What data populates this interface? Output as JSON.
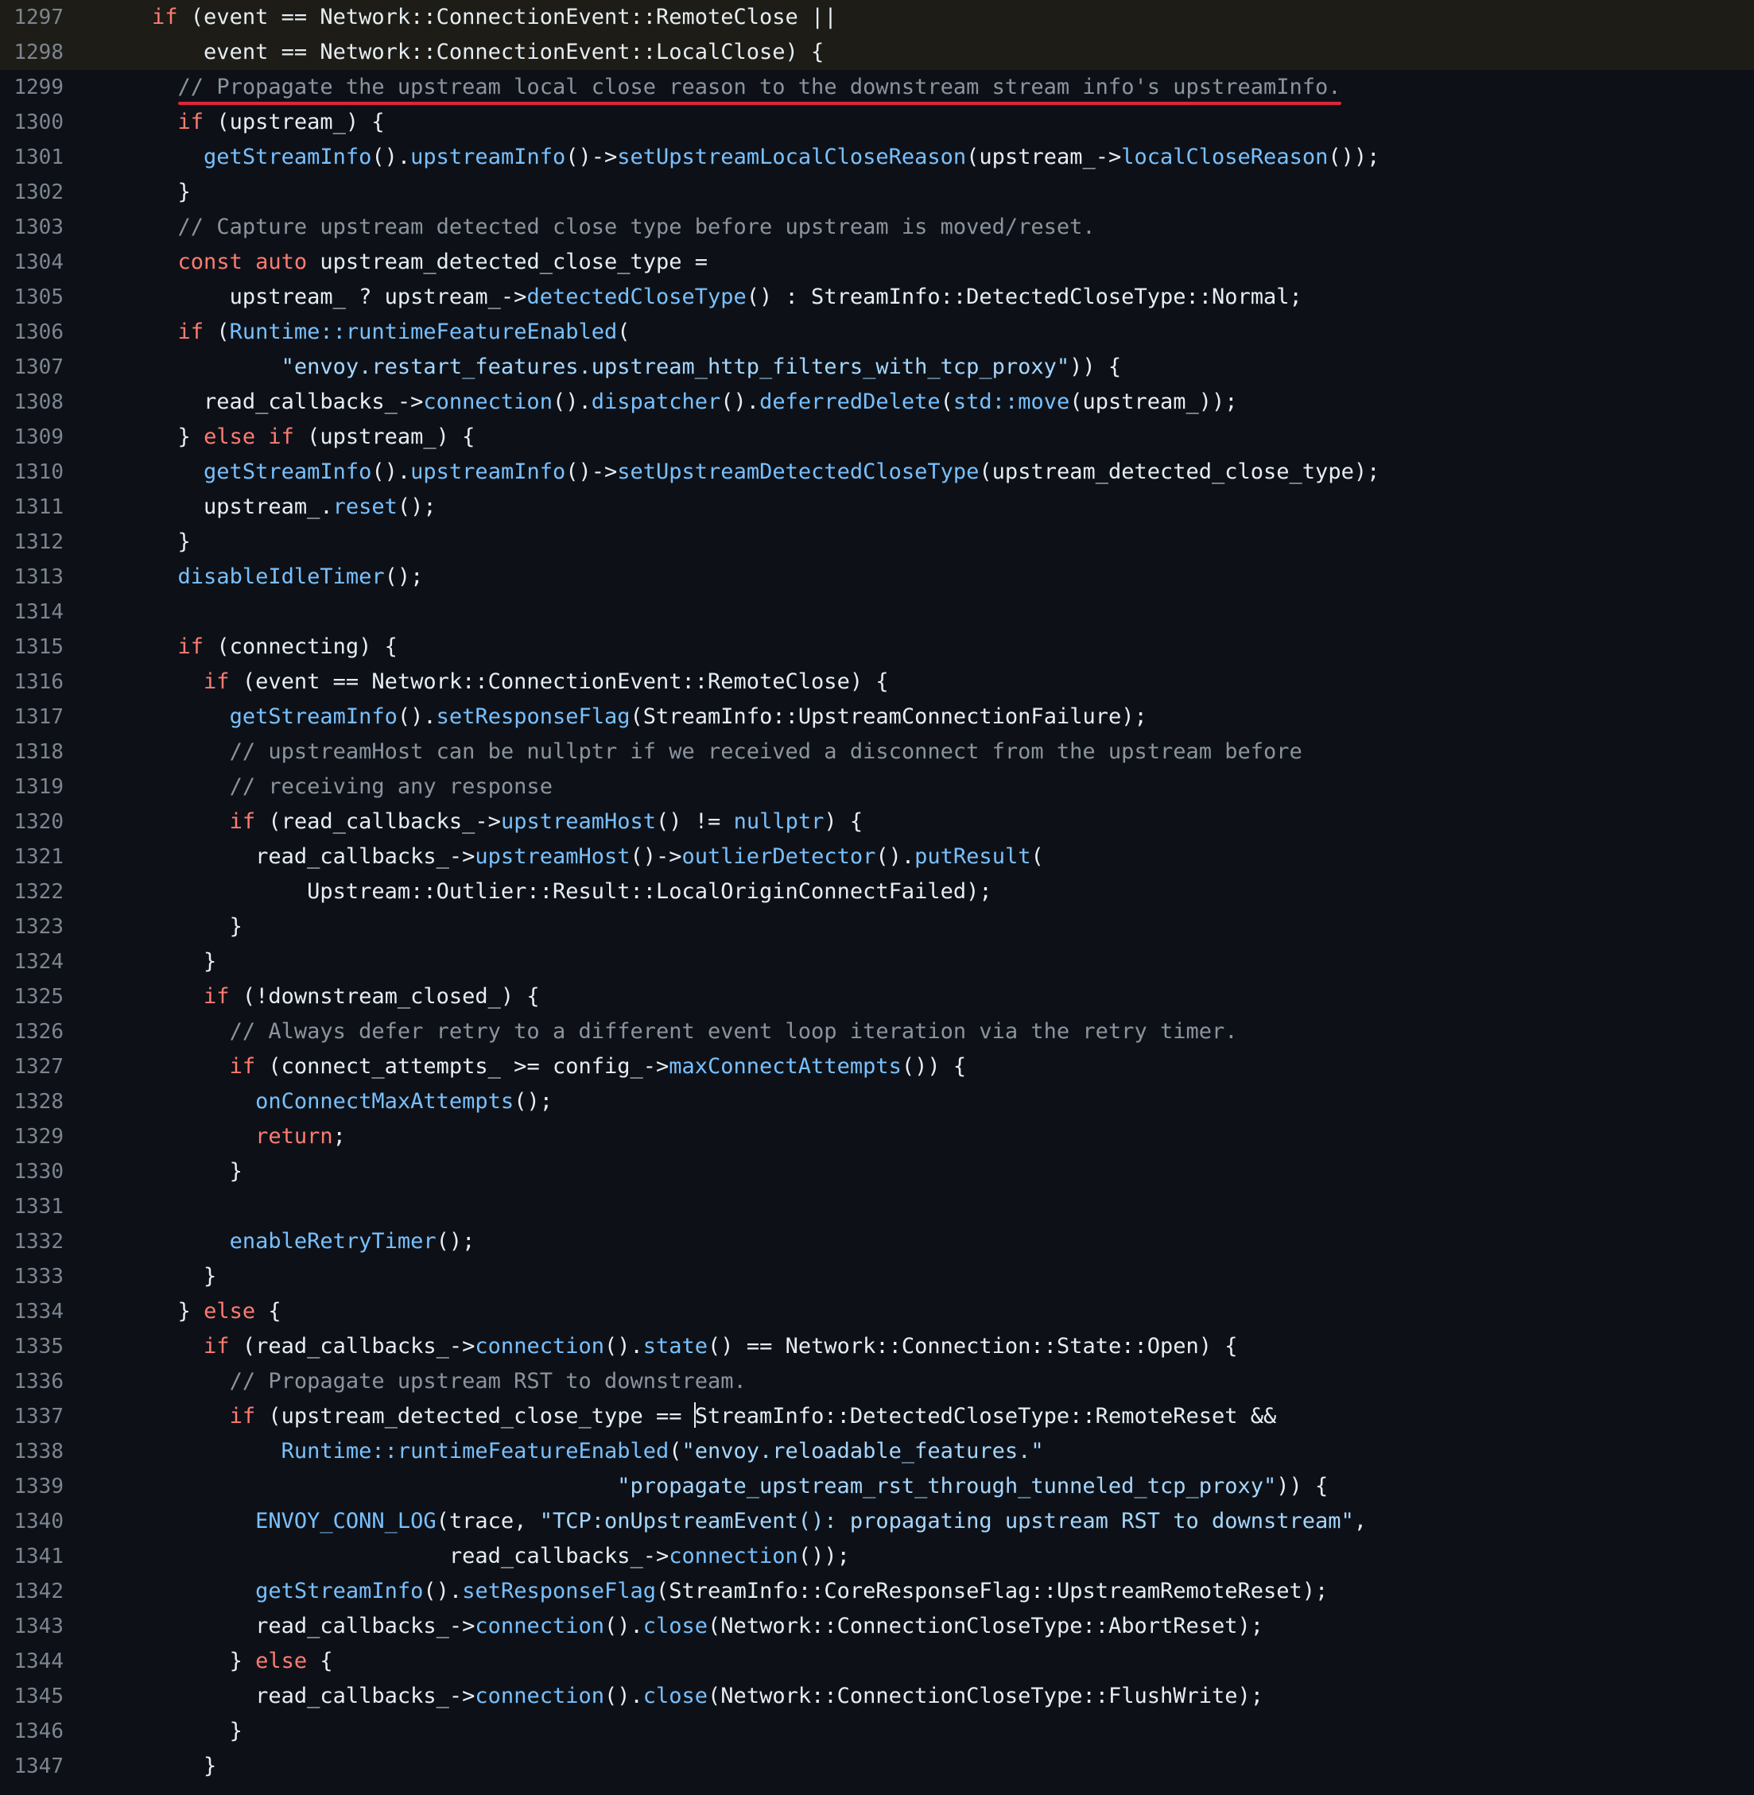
{
  "colors": {
    "background": "#0d1117",
    "highlight": "#1d1c16",
    "keyword": "#ff7b72",
    "function": "#79c0ff",
    "comment": "#8b949e",
    "string": "#a5d6ff",
    "text": "#e6edf3",
    "line_number": "#7d8590",
    "annotation": "#e0243c"
  },
  "code": {
    "highlighted_lines": [
      1297,
      1298
    ],
    "annotated_line": 1299,
    "caret_line": 1337,
    "lines": [
      {
        "n": "1297",
        "indent": 2,
        "tokens": [
          [
            "k",
            "if"
          ],
          [
            "t",
            " (event == Network::ConnectionEvent::RemoteClose ||"
          ]
        ]
      },
      {
        "n": "1298",
        "indent": 4,
        "tokens": [
          [
            "t",
            "event == Network::ConnectionEvent::LocalClose) {"
          ]
        ]
      },
      {
        "n": "1299",
        "indent": 3,
        "tokens": [
          [
            "c",
            "// Propagate the upstream local close reason to the downstream stream info's upstreamInfo."
          ]
        ]
      },
      {
        "n": "1300",
        "indent": 3,
        "tokens": [
          [
            "k",
            "if"
          ],
          [
            "t",
            " (upstream_) {"
          ]
        ]
      },
      {
        "n": "1301",
        "indent": 4,
        "tokens": [
          [
            "f",
            "getStreamInfo"
          ],
          [
            "t",
            "()."
          ],
          [
            "f",
            "upstreamInfo"
          ],
          [
            "t",
            "()->"
          ],
          [
            "f",
            "setUpstreamLocalCloseReason"
          ],
          [
            "t",
            "(upstream_->"
          ],
          [
            "f",
            "localCloseReason"
          ],
          [
            "t",
            "());"
          ]
        ]
      },
      {
        "n": "1302",
        "indent": 3,
        "tokens": [
          [
            "t",
            "}"
          ]
        ]
      },
      {
        "n": "1303",
        "indent": 3,
        "tokens": [
          [
            "c",
            "// Capture upstream detected close type before upstream is moved/reset."
          ]
        ]
      },
      {
        "n": "1304",
        "indent": 3,
        "tokens": [
          [
            "k",
            "const auto"
          ],
          [
            "t",
            " upstream_detected_close_type ="
          ]
        ]
      },
      {
        "n": "1305",
        "indent": 5,
        "tokens": [
          [
            "t",
            "upstream_ ? upstream_->"
          ],
          [
            "f",
            "detectedCloseType"
          ],
          [
            "t",
            "() : StreamInfo::DetectedCloseType::Normal;"
          ]
        ]
      },
      {
        "n": "1306",
        "indent": 3,
        "tokens": [
          [
            "k",
            "if"
          ],
          [
            "t",
            " ("
          ],
          [
            "f",
            "Runtime::runtimeFeatureEnabled"
          ],
          [
            "t",
            "("
          ]
        ]
      },
      {
        "n": "1307",
        "indent": 7,
        "tokens": [
          [
            "s",
            "\"envoy.restart_features.upstream_http_filters_with_tcp_proxy\""
          ],
          [
            "t",
            ")) {"
          ]
        ]
      },
      {
        "n": "1308",
        "indent": 4,
        "tokens": [
          [
            "t",
            "read_callbacks_->"
          ],
          [
            "f",
            "connection"
          ],
          [
            "t",
            "()."
          ],
          [
            "f",
            "dispatcher"
          ],
          [
            "t",
            "()."
          ],
          [
            "f",
            "deferredDelete"
          ],
          [
            "t",
            "("
          ],
          [
            "f",
            "std::move"
          ],
          [
            "t",
            "(upstream_));"
          ]
        ]
      },
      {
        "n": "1309",
        "indent": 3,
        "tokens": [
          [
            "t",
            "} "
          ],
          [
            "k",
            "else if"
          ],
          [
            "t",
            " (upstream_) {"
          ]
        ]
      },
      {
        "n": "1310",
        "indent": 4,
        "tokens": [
          [
            "f",
            "getStreamInfo"
          ],
          [
            "t",
            "()."
          ],
          [
            "f",
            "upstreamInfo"
          ],
          [
            "t",
            "()->"
          ],
          [
            "f",
            "setUpstreamDetectedCloseType"
          ],
          [
            "t",
            "(upstream_detected_close_type);"
          ]
        ]
      },
      {
        "n": "1311",
        "indent": 4,
        "tokens": [
          [
            "t",
            "upstream_."
          ],
          [
            "f",
            "reset"
          ],
          [
            "t",
            "();"
          ]
        ]
      },
      {
        "n": "1312",
        "indent": 3,
        "tokens": [
          [
            "t",
            "}"
          ]
        ]
      },
      {
        "n": "1313",
        "indent": 3,
        "tokens": [
          [
            "f",
            "disableIdleTimer"
          ],
          [
            "t",
            "();"
          ]
        ]
      },
      {
        "n": "1314",
        "indent": 0,
        "tokens": []
      },
      {
        "n": "1315",
        "indent": 3,
        "tokens": [
          [
            "k",
            "if"
          ],
          [
            "t",
            " (connecting) {"
          ]
        ]
      },
      {
        "n": "1316",
        "indent": 4,
        "tokens": [
          [
            "k",
            "if"
          ],
          [
            "t",
            " (event == Network::ConnectionEvent::RemoteClose) {"
          ]
        ]
      },
      {
        "n": "1317",
        "indent": 5,
        "tokens": [
          [
            "f",
            "getStreamInfo"
          ],
          [
            "t",
            "()."
          ],
          [
            "f",
            "setResponseFlag"
          ],
          [
            "t",
            "(StreamInfo::UpstreamConnectionFailure);"
          ]
        ]
      },
      {
        "n": "1318",
        "indent": 5,
        "tokens": [
          [
            "c",
            "// upstreamHost can be nullptr if we received a disconnect from the upstream before"
          ]
        ]
      },
      {
        "n": "1319",
        "indent": 5,
        "tokens": [
          [
            "c",
            "// receiving any response"
          ]
        ]
      },
      {
        "n": "1320",
        "indent": 5,
        "tokens": [
          [
            "k",
            "if"
          ],
          [
            "t",
            " (read_callbacks_->"
          ],
          [
            "f",
            "upstreamHost"
          ],
          [
            "t",
            "() != "
          ],
          [
            "f",
            "nullptr"
          ],
          [
            "t",
            ") {"
          ]
        ]
      },
      {
        "n": "1321",
        "indent": 6,
        "tokens": [
          [
            "t",
            "read_callbacks_->"
          ],
          [
            "f",
            "upstreamHost"
          ],
          [
            "t",
            "()->"
          ],
          [
            "f",
            "outlierDetector"
          ],
          [
            "t",
            "()."
          ],
          [
            "f",
            "putResult"
          ],
          [
            "t",
            "("
          ]
        ]
      },
      {
        "n": "1322",
        "indent": 8,
        "tokens": [
          [
            "t",
            "Upstream::Outlier::Result::LocalOriginConnectFailed);"
          ]
        ]
      },
      {
        "n": "1323",
        "indent": 5,
        "tokens": [
          [
            "t",
            "}"
          ]
        ]
      },
      {
        "n": "1324",
        "indent": 4,
        "tokens": [
          [
            "t",
            "}"
          ]
        ]
      },
      {
        "n": "1325",
        "indent": 4,
        "tokens": [
          [
            "k",
            "if"
          ],
          [
            "t",
            " (!downstream_closed_) {"
          ]
        ]
      },
      {
        "n": "1326",
        "indent": 5,
        "tokens": [
          [
            "c",
            "// Always defer retry to a different event loop iteration via the retry timer."
          ]
        ]
      },
      {
        "n": "1327",
        "indent": 5,
        "tokens": [
          [
            "k",
            "if"
          ],
          [
            "t",
            " (connect_attempts_ >= config_->"
          ],
          [
            "f",
            "maxConnectAttempts"
          ],
          [
            "t",
            "()) {"
          ]
        ]
      },
      {
        "n": "1328",
        "indent": 6,
        "tokens": [
          [
            "f",
            "onConnectMaxAttempts"
          ],
          [
            "t",
            "();"
          ]
        ]
      },
      {
        "n": "1329",
        "indent": 6,
        "tokens": [
          [
            "k",
            "return"
          ],
          [
            "t",
            ";"
          ]
        ]
      },
      {
        "n": "1330",
        "indent": 5,
        "tokens": [
          [
            "t",
            "}"
          ]
        ]
      },
      {
        "n": "1331",
        "indent": 0,
        "tokens": []
      },
      {
        "n": "1332",
        "indent": 5,
        "tokens": [
          [
            "f",
            "enableRetryTimer"
          ],
          [
            "t",
            "();"
          ]
        ]
      },
      {
        "n": "1333",
        "indent": 4,
        "tokens": [
          [
            "t",
            "}"
          ]
        ]
      },
      {
        "n": "1334",
        "indent": 3,
        "tokens": [
          [
            "t",
            "} "
          ],
          [
            "k",
            "else"
          ],
          [
            "t",
            " {"
          ]
        ]
      },
      {
        "n": "1335",
        "indent": 4,
        "tokens": [
          [
            "k",
            "if"
          ],
          [
            "t",
            " (read_callbacks_->"
          ],
          [
            "f",
            "connection"
          ],
          [
            "t",
            "()."
          ],
          [
            "f",
            "state"
          ],
          [
            "t",
            "() == Network::Connection::State::Open) {"
          ]
        ]
      },
      {
        "n": "1336",
        "indent": 5,
        "tokens": [
          [
            "c",
            "// Propagate upstream RST to downstream."
          ]
        ]
      },
      {
        "n": "1337",
        "indent": 5,
        "tokens": [
          [
            "k",
            "if"
          ],
          [
            "t",
            " (upstream_detected_close_type == StreamInfo::DetectedCloseType::RemoteReset &&"
          ]
        ]
      },
      {
        "n": "1338",
        "indent": 7,
        "tokens": [
          [
            "f",
            "Runtime::runtimeFeatureEnabled"
          ],
          [
            "t",
            "("
          ],
          [
            "s",
            "\"envoy.reloadable_features.\""
          ]
        ]
      },
      {
        "n": "1339",
        "indent": 0,
        "pad": "                                        ",
        "tokens": [
          [
            "s",
            "\"propagate_upstream_rst_through_tunneled_tcp_proxy\""
          ],
          [
            "t",
            ")) {"
          ]
        ]
      },
      {
        "n": "1340",
        "indent": 6,
        "tokens": [
          [
            "f",
            "ENVOY_CONN_LOG"
          ],
          [
            "t",
            "(trace, "
          ],
          [
            "s",
            "\"TCP:onUpstreamEvent(): propagating upstream RST to downstream\""
          ],
          [
            "t",
            ","
          ]
        ]
      },
      {
        "n": "1341",
        "indent": 0,
        "pad": "                           ",
        "tokens": [
          [
            "t",
            "read_callbacks_->"
          ],
          [
            "f",
            "connection"
          ],
          [
            "t",
            "());"
          ]
        ]
      },
      {
        "n": "1342",
        "indent": 6,
        "tokens": [
          [
            "f",
            "getStreamInfo"
          ],
          [
            "t",
            "()."
          ],
          [
            "f",
            "setResponseFlag"
          ],
          [
            "t",
            "(StreamInfo::CoreResponseFlag::UpstreamRemoteReset);"
          ]
        ]
      },
      {
        "n": "1343",
        "indent": 6,
        "tokens": [
          [
            "t",
            "read_callbacks_->"
          ],
          [
            "f",
            "connection"
          ],
          [
            "t",
            "()."
          ],
          [
            "f",
            "close"
          ],
          [
            "t",
            "(Network::ConnectionCloseType::AbortReset);"
          ]
        ]
      },
      {
        "n": "1344",
        "indent": 5,
        "tokens": [
          [
            "t",
            "} "
          ],
          [
            "k",
            "else"
          ],
          [
            "t",
            " {"
          ]
        ]
      },
      {
        "n": "1345",
        "indent": 6,
        "tokens": [
          [
            "t",
            "read_callbacks_->"
          ],
          [
            "f",
            "connection"
          ],
          [
            "t",
            "()."
          ],
          [
            "f",
            "close"
          ],
          [
            "t",
            "(Network::ConnectionCloseType::FlushWrite);"
          ]
        ]
      },
      {
        "n": "1346",
        "indent": 5,
        "tokens": [
          [
            "t",
            "}"
          ]
        ]
      },
      {
        "n": "1347",
        "indent": 4,
        "tokens": [
          [
            "t",
            "}"
          ]
        ]
      }
    ]
  }
}
